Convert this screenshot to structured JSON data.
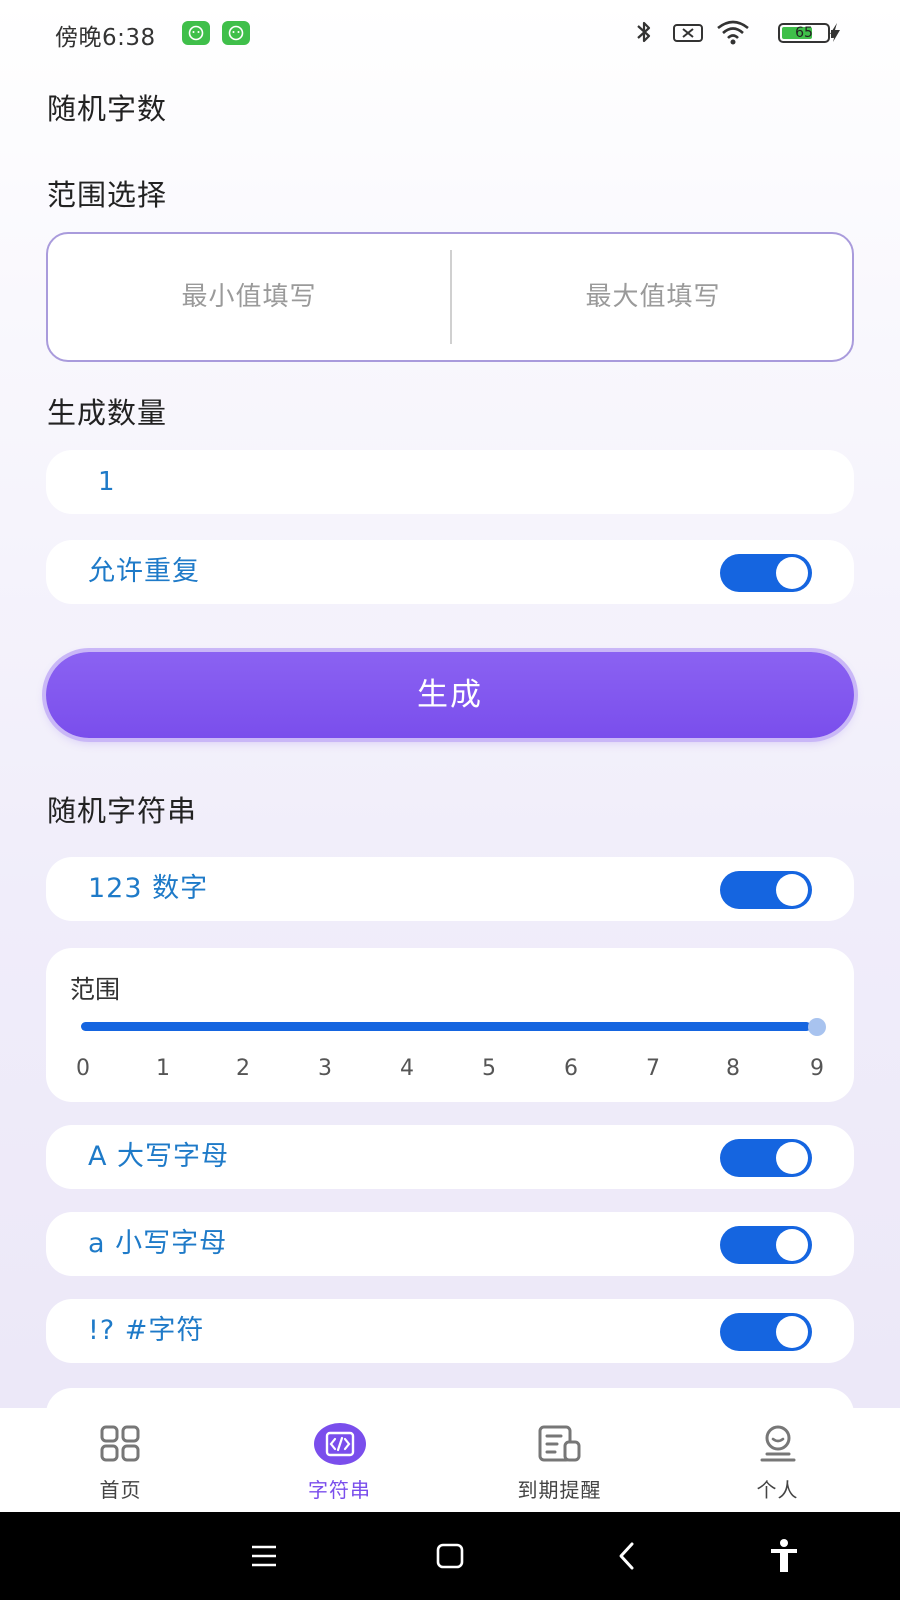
{
  "status_bar": {
    "time": "傍晚6:38",
    "battery_level": "65",
    "icons": [
      "notification-app-icon",
      "notification-app-icon",
      "bluetooth-icon",
      "sim-no-signal-icon",
      "wifi-icon",
      "battery-icon",
      "charging-icon"
    ]
  },
  "random_number": {
    "title": "随机字数",
    "range_title": "范围选择",
    "min_placeholder": "最小值填写",
    "max_placeholder": "最大值填写",
    "count_title": "生成数量",
    "count_value": "1",
    "allow_repeat_label": "允许重复",
    "allow_repeat_on": true,
    "generate_label": "生成"
  },
  "random_string": {
    "title": "随机字符串",
    "digits_label": "123 数字",
    "digits_on": true,
    "range_label": "范围",
    "range_ticks": [
      "0",
      "1",
      "2",
      "3",
      "4",
      "5",
      "6",
      "7",
      "8",
      "9"
    ],
    "range_value": 9,
    "upper_label": "A 大写字母",
    "upper_on": true,
    "lower_label": "a 小写字母",
    "lower_on": true,
    "symbols_label": "!? #字符",
    "symbols_on": true
  },
  "tabbar": {
    "tabs": [
      {
        "label": "首页",
        "icon": "home-grid-icon"
      },
      {
        "label": "字符串",
        "icon": "code-icon",
        "active": true
      },
      {
        "label": "到期提醒",
        "icon": "reminder-icon"
      },
      {
        "label": "个人",
        "icon": "profile-icon"
      }
    ]
  },
  "colors": {
    "accent_purple": "#7a4eec",
    "toggle_blue": "#1565e0",
    "label_blue": "#1e7ac8"
  }
}
